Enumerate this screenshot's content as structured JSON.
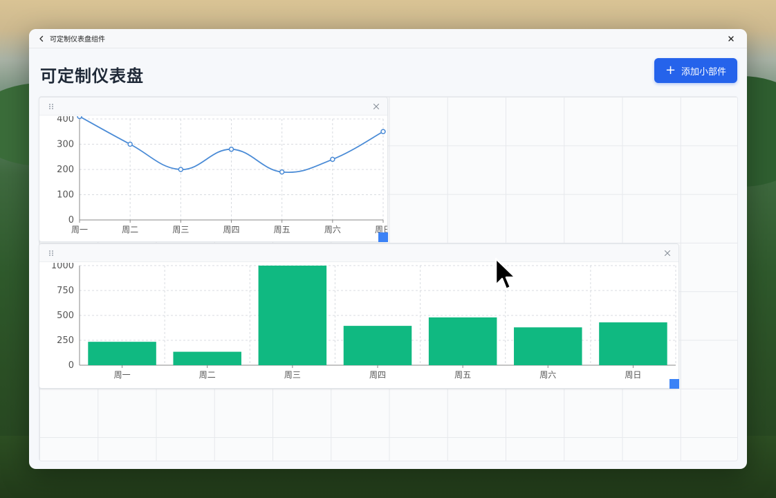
{
  "window": {
    "title": "可定制仪表盘组件"
  },
  "header": {
    "page_title": "可定制仪表盘",
    "add_button_label": "添加小部件"
  },
  "colors": {
    "accent": "#2563eb",
    "line_series": "#4a8bd6",
    "bar_series": "#10b981",
    "resize_handle": "#3b82f6"
  },
  "chart_data": [
    {
      "type": "line",
      "categories": [
        "周一",
        "周二",
        "周三",
        "周四",
        "周五",
        "周六",
        "周日"
      ],
      "values": [
        410,
        300,
        200,
        280,
        190,
        240,
        350
      ],
      "ylim": [
        0,
        400
      ],
      "yticks": [
        0,
        100,
        200,
        300,
        400
      ],
      "title": "",
      "xlabel": "",
      "ylabel": "",
      "grid": true,
      "smooth": true
    },
    {
      "type": "bar",
      "categories": [
        "周一",
        "周二",
        "周三",
        "周四",
        "周五",
        "周六",
        "周日"
      ],
      "values": [
        235,
        135,
        1000,
        395,
        480,
        380,
        430
      ],
      "ylim": [
        0,
        1000
      ],
      "yticks": [
        0,
        250,
        500,
        750,
        1000
      ],
      "title": "",
      "xlabel": "",
      "ylabel": "",
      "grid": true
    }
  ]
}
